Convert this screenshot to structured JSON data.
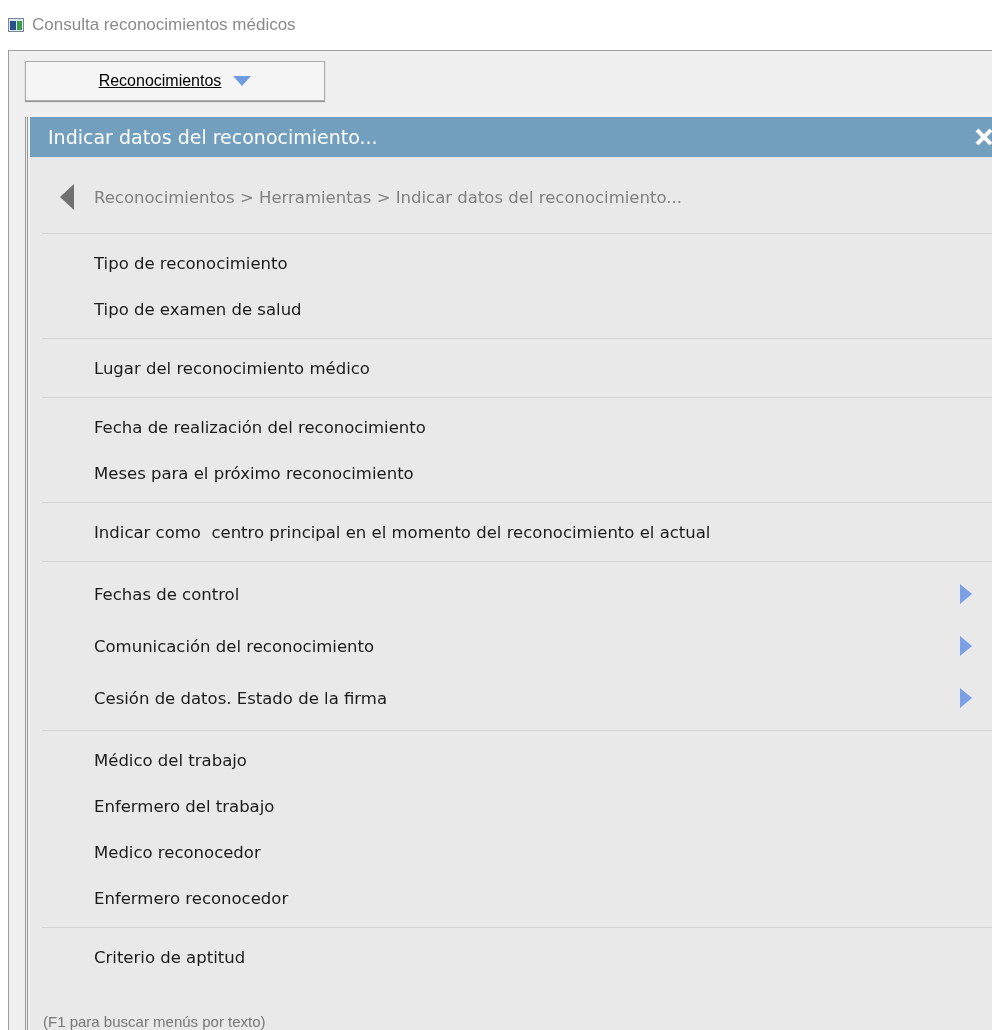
{
  "window": {
    "title": "Consulta reconocimientos médicos"
  },
  "menu_button": {
    "label": "Reconocimientos"
  },
  "panel": {
    "title": "Indicar datos del reconocimiento...",
    "breadcrumb": "Reconocimientos > Herramientas > Indicar datos del reconocimiento...",
    "groups": [
      {
        "items": [
          {
            "label": "Tipo de reconocimiento",
            "kind": "action"
          },
          {
            "label": "Tipo de examen de salud",
            "kind": "action"
          }
        ]
      },
      {
        "items": [
          {
            "label": "Lugar del reconocimiento médico",
            "kind": "action"
          }
        ]
      },
      {
        "items": [
          {
            "label": "Fecha de realización del reconocimiento",
            "kind": "action"
          },
          {
            "label": "Meses para el próximo reconocimiento",
            "kind": "action"
          }
        ]
      },
      {
        "items": [
          {
            "label": "Indicar como  centro principal en el momento del reconocimiento el actual",
            "kind": "action"
          }
        ]
      },
      {
        "items": [
          {
            "label": "Fechas de control",
            "kind": "submenu"
          },
          {
            "label": "Comunicación del reconocimiento",
            "kind": "submenu"
          },
          {
            "label": "Cesión de datos. Estado de la firma",
            "kind": "submenu"
          }
        ]
      },
      {
        "items": [
          {
            "label": "Médico del trabajo",
            "kind": "action"
          },
          {
            "label": "Enfermero del trabajo",
            "kind": "action"
          },
          {
            "label": "Medico reconocedor",
            "kind": "action"
          },
          {
            "label": "Enfermero reconocedor",
            "kind": "action"
          }
        ]
      },
      {
        "items": [
          {
            "label": "Criterio de aptitud",
            "kind": "action"
          }
        ]
      }
    ]
  },
  "hint": "(F1 para buscar menús por texto)"
}
